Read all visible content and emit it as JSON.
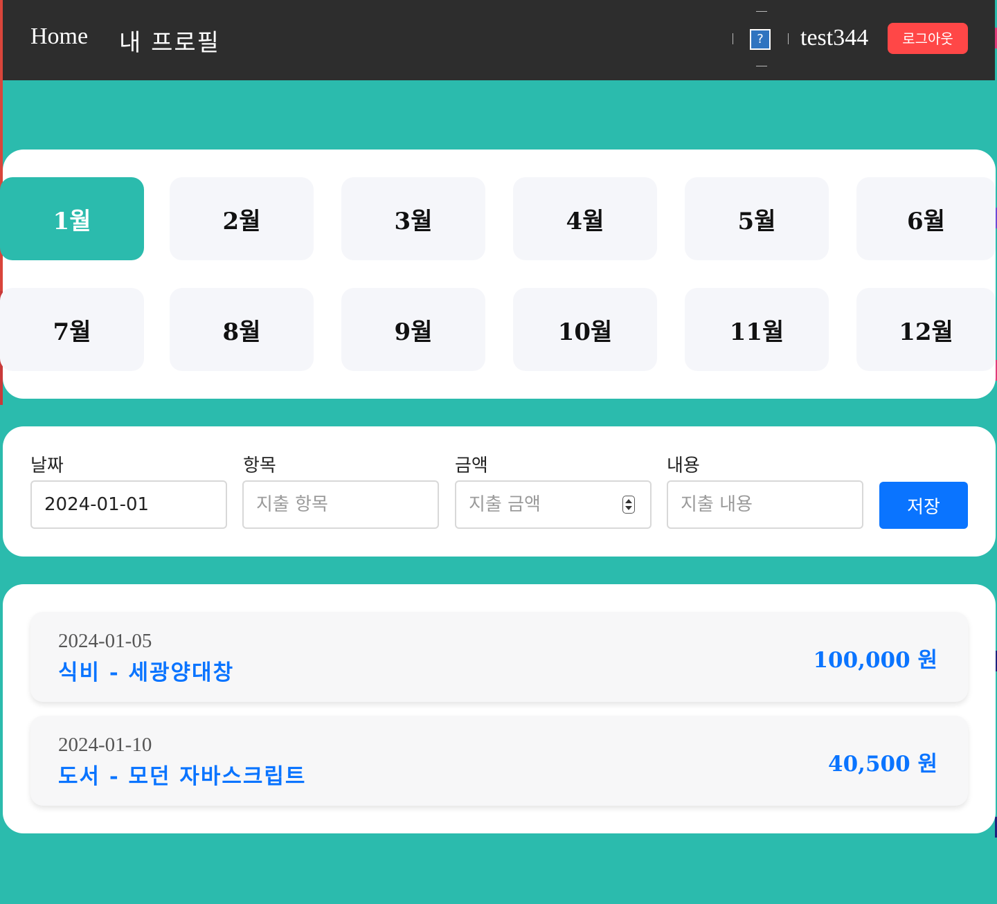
{
  "nav": {
    "home": "Home",
    "profile": "내 프로필",
    "help_icon": "?",
    "username": "test344",
    "logout": "로그아웃"
  },
  "months": [
    "1월",
    "2월",
    "3월",
    "4월",
    "5월",
    "6월",
    "7월",
    "8월",
    "9월",
    "10월",
    "11월",
    "12월"
  ],
  "selected_month": "1월",
  "form": {
    "date": {
      "label": "날짜",
      "value": "2024-01-01"
    },
    "item": {
      "label": "항목",
      "placeholder": "지출 항목"
    },
    "amount": {
      "label": "금액",
      "placeholder": "지출 금액"
    },
    "content": {
      "label": "내용",
      "placeholder": "지출 내용"
    },
    "save": "저장"
  },
  "entries": [
    {
      "date": "2024-01-05",
      "title": "식비 - 세광양대창",
      "amount": "100,000 원"
    },
    {
      "date": "2024-01-10",
      "title": "도서 - 모던 자바스크립트",
      "amount": "40,500 원"
    }
  ],
  "colors": {
    "accent": "#2bbbad",
    "header": "#2d2d2d",
    "logout": "#ff4747",
    "primary": "#0a74ff"
  },
  "icons": {
    "help": "question-mark-icon",
    "spinner": "number-spinner-icon"
  }
}
